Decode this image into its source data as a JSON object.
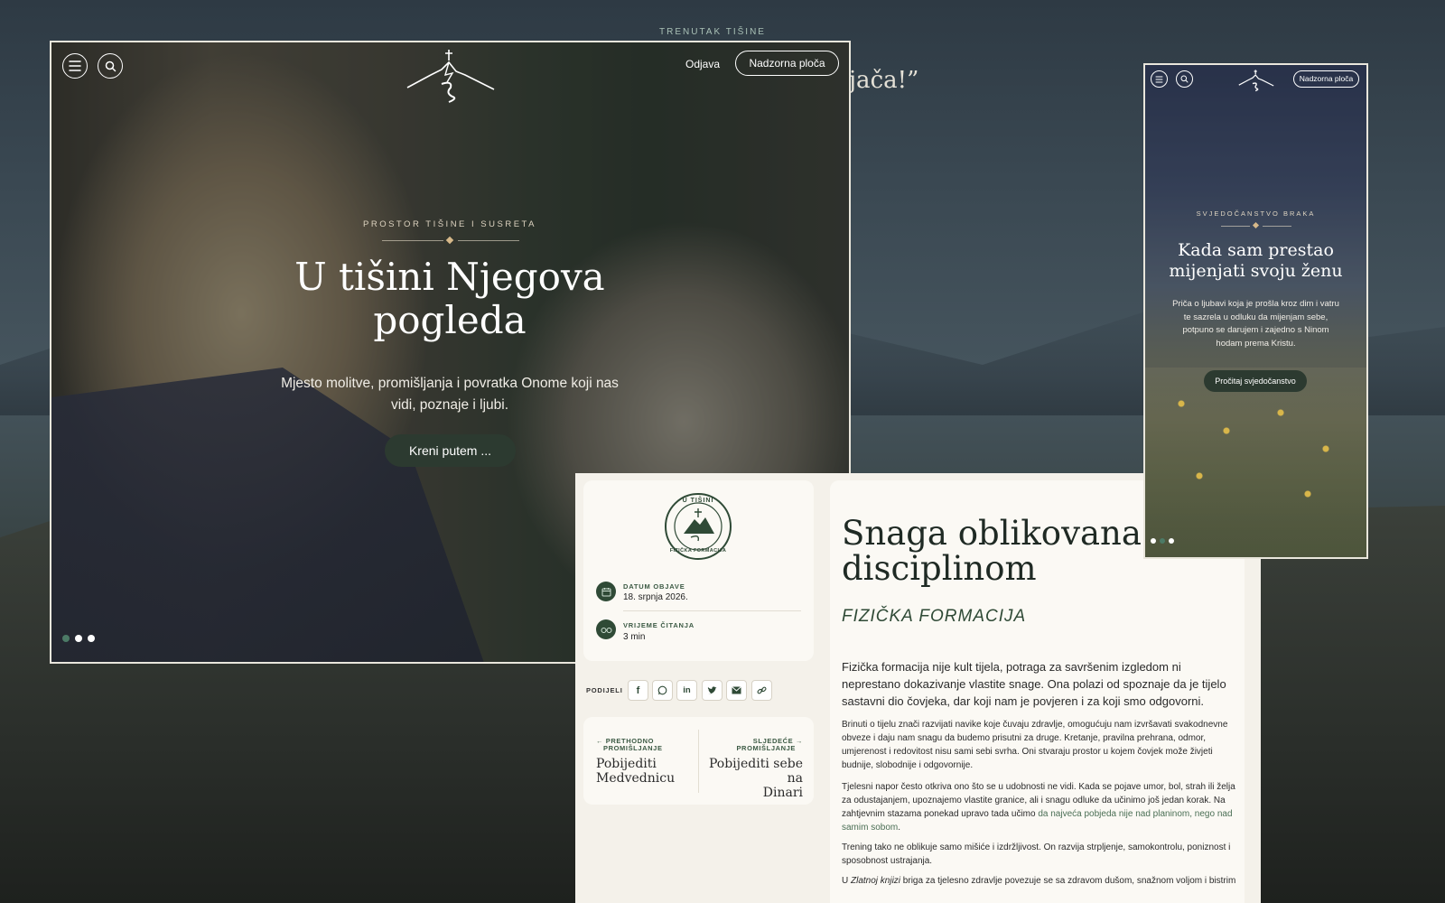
{
  "background": {
    "eyebrow": "TRENUTAK TIŠINE",
    "quote_fragment": "jača!”"
  },
  "desktop": {
    "nav": {
      "logout": "Odjava",
      "dashboard": "Nadzorna ploča"
    },
    "hero": {
      "eyebrow": "PROSTOR TIŠINE I SUSRETA",
      "title_line1": "U tišini Njegova",
      "title_line2": "pogleda",
      "subtitle_line1": "Mjesto molitve, promišljanja i povratka Onome koji nas",
      "subtitle_line2": "vidi, poznaje i ljubi.",
      "cta": "Kreni putem ..."
    }
  },
  "mobile": {
    "nav": {
      "dashboard": "Nadzorna ploča"
    },
    "hero": {
      "eyebrow": "SVJEDOČANSTVO BRAKA",
      "title_line1": "Kada sam prestao",
      "title_line2": "mijenjati svoju ženu",
      "body_line1": "Priča o ljubavi koja je prošla kroz dim i vatru",
      "body_line2": "te sazrela u odluku da mijenjam sebe,",
      "body_line3": "potpuno se darujem i zajedno s Ninom",
      "body_line4": "hodam prema Kristu.",
      "cta": "Pročitaj svjedočanstvo"
    }
  },
  "article": {
    "badge": {
      "top": "U TIŠINI",
      "bottom": "FIZIČKA FORMACIJA"
    },
    "meta": {
      "date_label": "DATUM OBJAVE",
      "date_value": "18. srpnja 2026.",
      "read_label": "VRIJEME ČITANJA",
      "read_value": "3 min"
    },
    "share_label": "PODIJELI",
    "share_icons": [
      "facebook-icon",
      "whatsapp-icon",
      "linkedin-icon",
      "twitter-icon",
      "email-icon",
      "link-icon"
    ],
    "prev": {
      "label_line1": "PRETHODNO",
      "label_line2": "PROMIŠLJANJE",
      "title_line1": "Pobijediti",
      "title_line2": "Medvednicu"
    },
    "next": {
      "label_line1": "SLJEDEĆE",
      "label_line2": "PROMIŠLJANJE",
      "title_line1": "Pobijediti sebe na",
      "title_line2": "Dinari"
    },
    "title_line1": "Snaga oblikovana",
    "title_line2": "disciplinom",
    "category": "FIZIČKA FORMACIJA",
    "lead": "Fizička formacija nije kult tijela, potraga za savršenim izgledom ni neprestano dokazivanje vlastite snage. Ona polazi od spoznaje da je tijelo sastavni dio čovjeka, dar koji nam je povjeren i za koji smo odgovorni.",
    "p1": "Brinuti o tijelu znači razvijati navike koje čuvaju zdravlje, omogućuju nam izvršavati svakodnevne obveze i daju nam snagu da budemo prisutni za druge. Kretanje, pravilna prehrana, odmor, umjerenost i redovitost nisu sami sebi svrha. Oni stvaraju prostor u kojem čovjek može živjeti budnije, slobodnije i odgovornije.",
    "p2_start": "Tjelesni napor često otkriva ono što se u udobnosti ne vidi. Kada se pojave umor, bol, strah ili želja za odustajanjem, upoznajemo vlastite granice, ali i snagu odluke da učinimo još jedan korak. Na zahtjevnim stazama ponekad upravo tada učimo ",
    "p2_link": "da najveća pobjeda nije nad planinom, nego nad samim sobom",
    "p2_end": ".",
    "p3": "Trening tako ne oblikuje samo mišiće i izdržljivost. On razvija strpljenje, samokontrolu, poniznost i sposobnost ustrajanja.",
    "p4_start": "U ",
    "p4_em": "Zlatnoj knjizi",
    "p4_end": " briga za tjelesno zdravlje povezuje se sa zdravom dušom, snažnom voljom i bistrim"
  }
}
